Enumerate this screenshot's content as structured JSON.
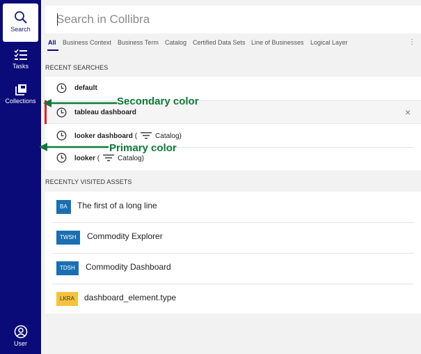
{
  "sidebar": {
    "items": [
      {
        "label": "Search"
      },
      {
        "label": "Tasks"
      },
      {
        "label": "Collections"
      }
    ],
    "user_label": "User"
  },
  "search": {
    "placeholder": "Search in Collibra"
  },
  "tabs": [
    {
      "label": "All"
    },
    {
      "label": "Business Context"
    },
    {
      "label": "Business Term"
    },
    {
      "label": "Catalog"
    },
    {
      "label": "Certified Data Sets"
    },
    {
      "label": "Line of Businesses"
    },
    {
      "label": "Logical Layer"
    }
  ],
  "tabs_more": "⋮",
  "recent_searches": {
    "title": "RECENT SEARCHES",
    "items": [
      {
        "term": "default"
      },
      {
        "term": "tableau dashboard"
      },
      {
        "term": "looker dashboard",
        "open": "(",
        "filter": "Catalog)"
      },
      {
        "term": "looker",
        "open": "(",
        "filter": "Catalog)"
      }
    ],
    "close": "×"
  },
  "recently_visited": {
    "title": "RECENTLY VISITED ASSETS",
    "items": [
      {
        "badge": "BA",
        "name": "The first of a long line"
      },
      {
        "badge": "TWSH",
        "name": "Commodity Explorer"
      },
      {
        "badge": "TDSH",
        "name": "Commodity Dashboard"
      },
      {
        "badge": "LKRA",
        "name": "dashboard_element.type"
      }
    ]
  },
  "annotations": {
    "secondary": "Secondary color",
    "primary": "Primary color"
  },
  "colors": {
    "primary": "#0a0a78",
    "secondary_hover": "#f5f5f5",
    "accent_red": "#e02020",
    "annotation_green": "#0f7a3a",
    "badge_blue": "#1a6fb3",
    "badge_yellow": "#f5c33b"
  },
  "icons": {
    "search": "search-icon",
    "tasks": "tasks-icon",
    "collections": "collections-icon",
    "user": "user-icon",
    "clock": "clock-icon",
    "filter": "filter-icon",
    "close": "close-icon",
    "more": "more-icon"
  }
}
